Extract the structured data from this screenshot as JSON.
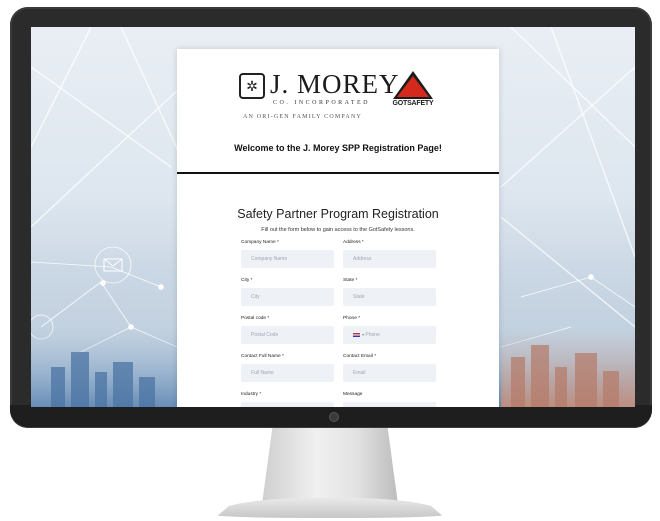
{
  "brand": {
    "jmorey_name": "J. MOREY",
    "jmorey_sub": "CO. INCORPORATED",
    "jmorey_tagline": "AN ORI-GEN FAMILY COMPANY",
    "gs_initials": "GS",
    "gs_name": "GOTSAFETY",
    "gs_domain": ".com"
  },
  "header": {
    "welcome": "Welcome to the J. Morey SPP Registration Page!"
  },
  "form": {
    "title": "Safety Partner Program Registration",
    "subtitle": "Fill out the form below to gain access to the GotSafety lessons.",
    "fields": [
      {
        "label": "Company Name *",
        "placeholder": "Company Name"
      },
      {
        "label": "Address *",
        "placeholder": "Address"
      },
      {
        "label": "City *",
        "placeholder": "City"
      },
      {
        "label": "State *",
        "placeholder": "State"
      },
      {
        "label": "Postal code *",
        "placeholder": "Postal Code"
      },
      {
        "label": "Phone *",
        "placeholder": "Phone"
      },
      {
        "label": "Contact Full Name *",
        "placeholder": "Full Name"
      },
      {
        "label": "Contact Email *",
        "placeholder": "Email"
      },
      {
        "label": "Industry *",
        "placeholder": ""
      },
      {
        "label": "Message",
        "placeholder": ""
      }
    ]
  },
  "colors": {
    "gs_red": "#d42a1e",
    "field_bg": "#eef1f6",
    "monitor_bezel": "#2b2b2b"
  },
  "icons": {
    "jmorey_emblem": "gear-cluster-icon",
    "phone_country": "us-flag-icon",
    "background_mail": "envelope-icon"
  }
}
